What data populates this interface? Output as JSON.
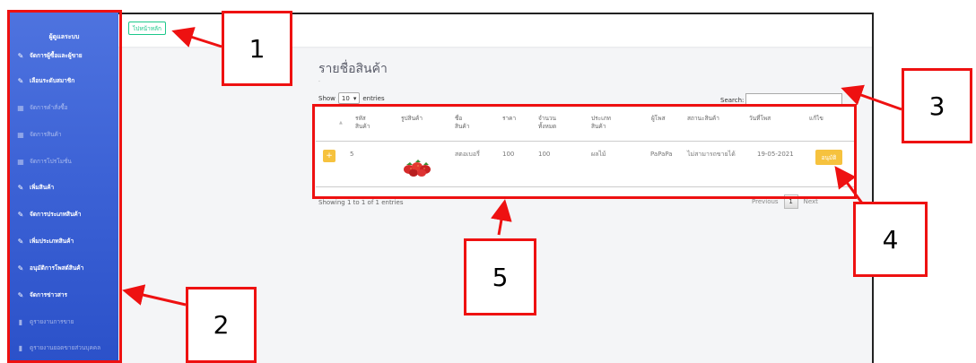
{
  "sidebar": {
    "brand": "ผู้ดูแลระบบ",
    "items": [
      {
        "label": "จัดการผู้ซื้อและผู้ขาย",
        "icon": "wrench-icon",
        "dim": false
      },
      {
        "label": "เลือนระดับสมาชิก",
        "icon": "wrench-icon",
        "dim": false
      },
      {
        "label": "จัดการคำสั่งซื้อ",
        "icon": "table-icon",
        "dim": true
      },
      {
        "label": "จัดการสินค้า",
        "icon": "table-icon",
        "dim": true
      },
      {
        "label": "จัดการโปรโมชั่น",
        "icon": "table-icon",
        "dim": true
      },
      {
        "label": "เพิ่มสินค้า",
        "icon": "wrench-icon",
        "dim": false
      },
      {
        "label": "จัดการประเภทสินค้า",
        "icon": "wrench-icon",
        "dim": false
      },
      {
        "label": "เพิ่มประเภทสินค้า",
        "icon": "wrench-icon",
        "dim": false
      },
      {
        "label": "อนุมัติการโพสต์สินค้า",
        "icon": "wrench-icon",
        "dim": false
      },
      {
        "label": "จัดการข่าวสาร",
        "icon": "wrench-icon",
        "dim": false
      },
      {
        "label": "ดูรายงานการขาย",
        "icon": "chart-icon",
        "dim": true
      },
      {
        "label": "ดูรายงานยอดขายส่วนบุคคล",
        "icon": "chart-icon",
        "dim": true
      }
    ]
  },
  "topbar": {
    "home_label": "ไปหน้าหลัก"
  },
  "main": {
    "title": "รายชื่อสินค้า",
    "dot": ".",
    "show_label": "Show",
    "entries_value": "10",
    "entries_label": "entries",
    "search_label": "Search:",
    "showing_text": "Showing 1 to 1 of 1 entries",
    "previous": "Previous",
    "next": "Next",
    "page": "1"
  },
  "table": {
    "headers": [
      "รหัส สินค้า",
      "รูปสินค้า",
      "ชื่อ สินค้า",
      "ราคา",
      "จำนวน ทั้งหมด",
      "ประเภท สินค้า",
      "ผู้โพส",
      "สถานะสินค้า",
      "วันที่โพส",
      "แก้ไข"
    ],
    "row": {
      "id": "5",
      "name": "สตอเบอรี่",
      "price": "100",
      "qty": "100",
      "type": "ผลไม้",
      "poster": "PaPaPa",
      "status": "ไม่สามารถขายได้",
      "date": "19-05-2021",
      "action": "อนุมัติ"
    }
  },
  "callouts": [
    "1",
    "2",
    "3",
    "4",
    "5"
  ],
  "colors": {
    "sidebar": "#4e73df",
    "accent": "#f6c23e",
    "success": "#1cc88a",
    "annotation": "#ee1111"
  }
}
